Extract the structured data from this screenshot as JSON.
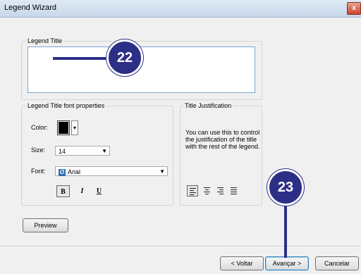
{
  "window": {
    "title": "Legend Wizard",
    "close_symbol": "x"
  },
  "legend_title_group": {
    "label": "Legend Title",
    "value": ""
  },
  "font_props": {
    "label": "Legend Title font properties",
    "color_label": "Color:",
    "color_value": "#000000",
    "size_label": "Size:",
    "size_value": "14",
    "font_label": "Font:",
    "font_value": "Arial",
    "bold": "B",
    "italic": "I",
    "underline": "U"
  },
  "justification": {
    "label": "Title Justification",
    "description": "You can use this to control the justification of the title with the rest of the legend.",
    "selected": "left"
  },
  "buttons": {
    "preview": "Preview",
    "back": "< Voltar",
    "next": "Avançar >",
    "cancel": "Cancelar"
  },
  "callouts": {
    "a": "22",
    "b": "23"
  },
  "colors": {
    "callout": "#2c2f86",
    "accent": "#3c7fb1"
  }
}
